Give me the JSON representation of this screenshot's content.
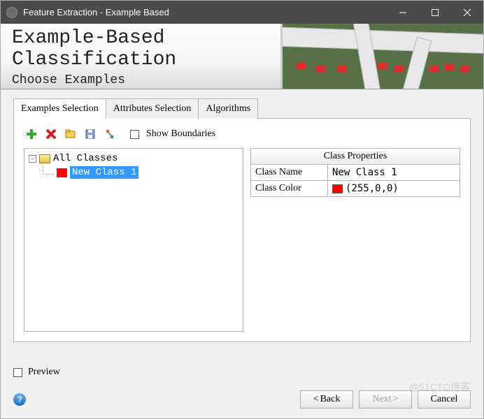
{
  "window": {
    "title": "Feature Extraction - Example Based"
  },
  "header": {
    "title": "Example-Based Classification",
    "subtitle": "Choose Examples"
  },
  "tabs": [
    {
      "label": "Examples Selection",
      "active": true
    },
    {
      "label": "Attributes Selection",
      "active": false
    },
    {
      "label": "Algorithms",
      "active": false
    }
  ],
  "toolbar": {
    "show_boundaries_label": "Show Boundaries",
    "show_boundaries_checked": false,
    "icons": {
      "add": "add-icon",
      "delete": "delete-icon",
      "open": "open-icon",
      "save": "save-icon",
      "compute": "compute-icon"
    }
  },
  "tree": {
    "root_label": "All Classes",
    "root_expanded": true,
    "children": [
      {
        "label": "New Class 1",
        "color": "#ff0000",
        "selected": true
      }
    ]
  },
  "properties": {
    "header": "Class Properties",
    "rows": [
      {
        "label": "Class Name",
        "value": "New Class 1"
      },
      {
        "label": "Class Color",
        "value": "(255,0,0)",
        "color": "#ff0000"
      }
    ]
  },
  "footer": {
    "preview_label": "Preview",
    "preview_checked": false,
    "buttons": {
      "back": "Back",
      "next": "Next",
      "cancel": "Cancel"
    },
    "next_disabled": true
  },
  "watermark": "@51CTO博客"
}
